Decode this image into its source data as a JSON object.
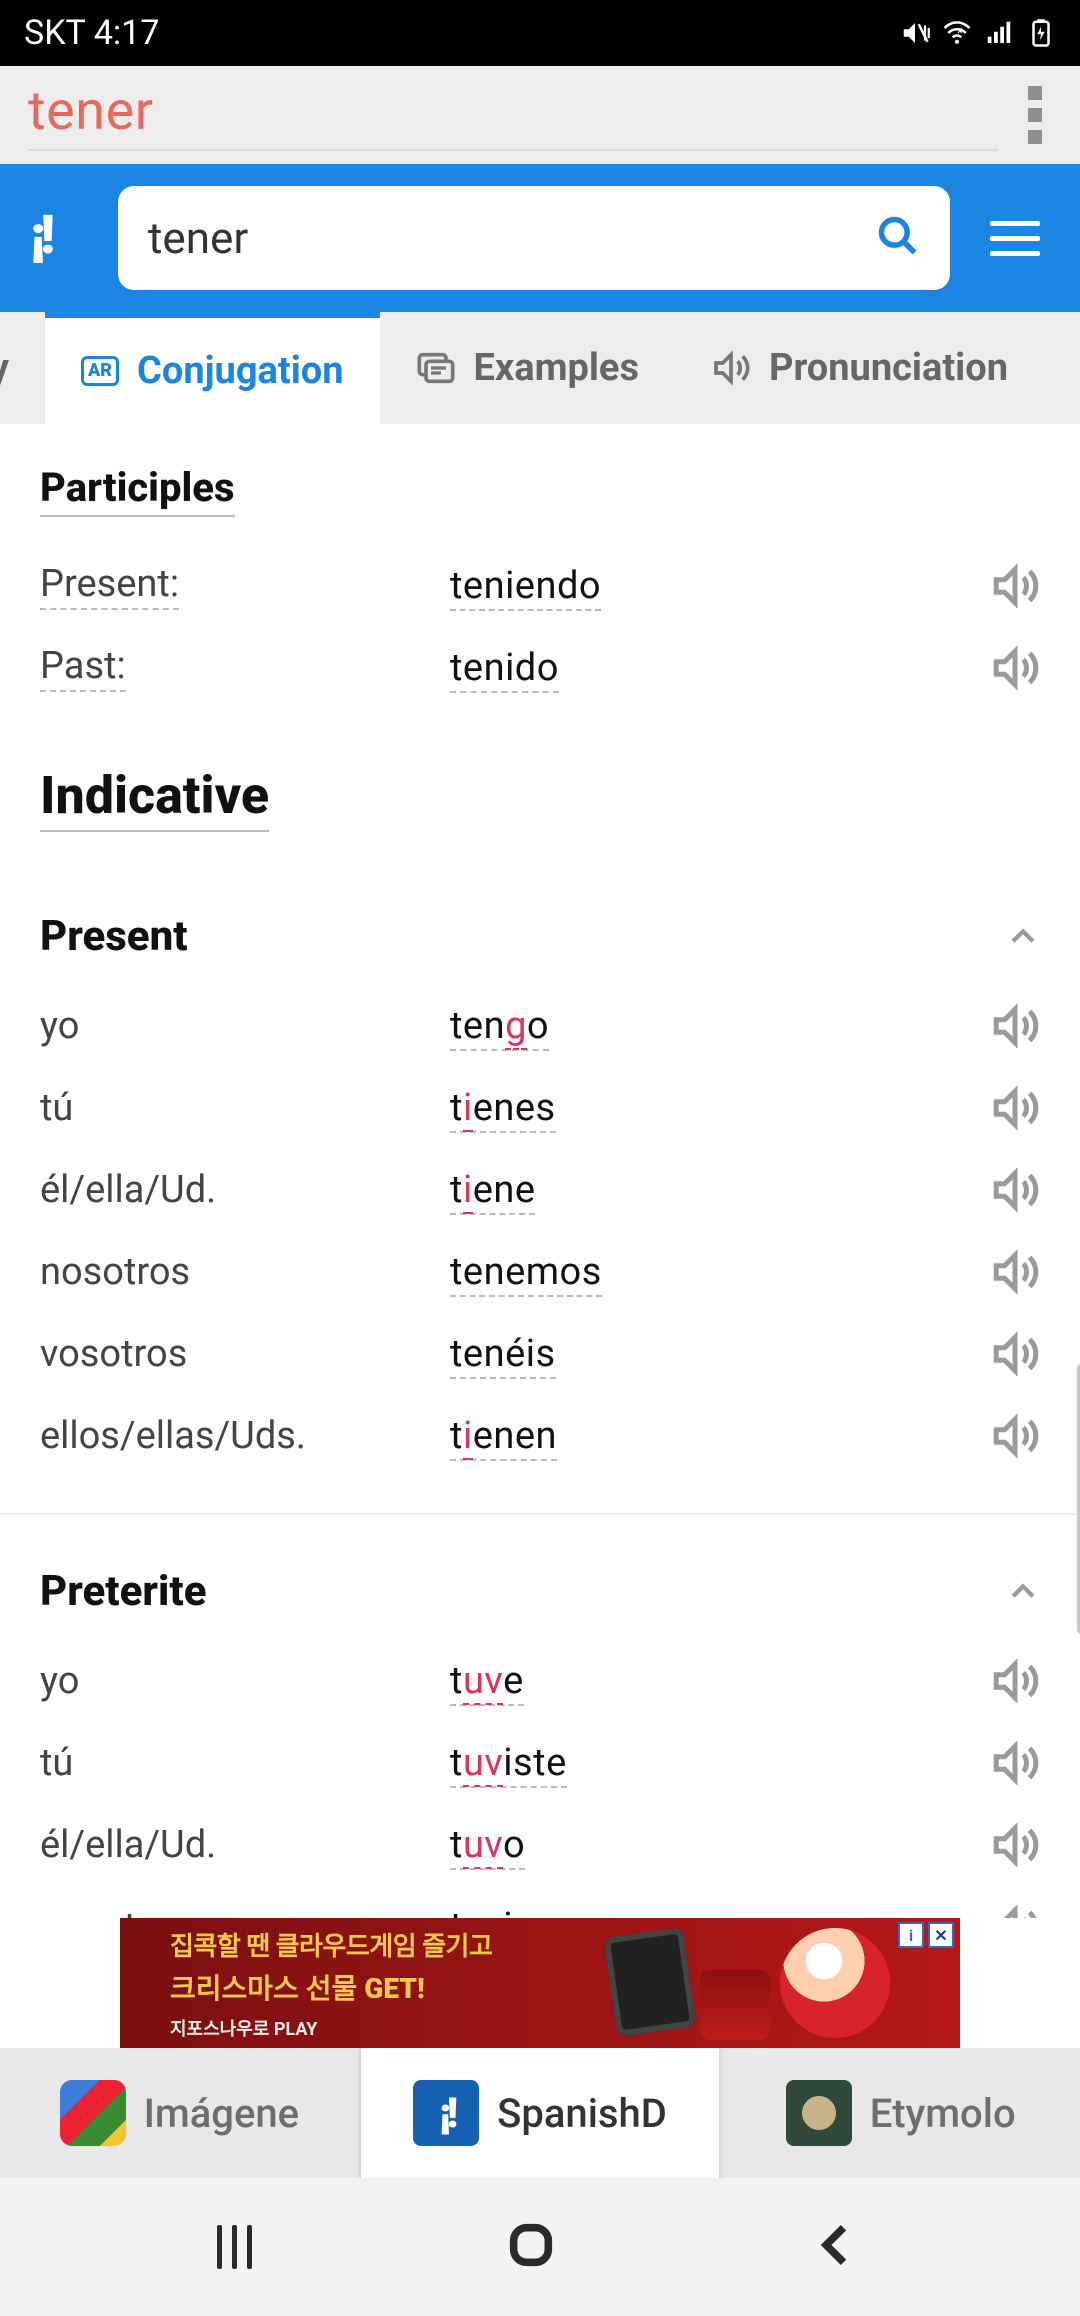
{
  "status": {
    "carrier": "SKT",
    "time": "4:17"
  },
  "urlbar": {
    "title": "tener"
  },
  "search": {
    "value": "tener"
  },
  "tabs": {
    "left_partial": "ry",
    "conjugation": "Conjugation",
    "examples": "Examples",
    "pronunciation": "Pronunciation"
  },
  "sections": {
    "participles": {
      "title": "Participles",
      "present_label": "Present:",
      "present_form": "teniendo",
      "past_label": "Past:",
      "past_form": "tenido"
    },
    "indicative": {
      "title": "Indicative"
    },
    "present": {
      "title": "Present",
      "rows": [
        {
          "pron": "yo",
          "pre": "ten",
          "hl": "g",
          "post": "o"
        },
        {
          "pron": "tú",
          "pre": "t",
          "hl": "i",
          "post": "enes"
        },
        {
          "pron": "él/ella/Ud.",
          "pre": "t",
          "hl": "i",
          "post": "ene"
        },
        {
          "pron": "nosotros",
          "pre": "tenemos",
          "hl": "",
          "post": ""
        },
        {
          "pron": "vosotros",
          "pre": "tenéis",
          "hl": "",
          "post": ""
        },
        {
          "pron": "ellos/ellas/Uds.",
          "pre": "t",
          "hl": "i",
          "post": "enen"
        }
      ]
    },
    "preterite": {
      "title": "Preterite",
      "rows": [
        {
          "pron": "yo",
          "pre": "t",
          "hl": "uv",
          "post": "e"
        },
        {
          "pron": "tú",
          "pre": "t",
          "hl": "uv",
          "post": "iste"
        },
        {
          "pron": "él/ella/Ud.",
          "pre": "t",
          "hl": "uv",
          "post": "o"
        },
        {
          "pron": "nosotros",
          "pre": "t",
          "hl": "uv",
          "post": "imos"
        }
      ]
    }
  },
  "ad": {
    "line1": "집콕할 땐 클라우드게임 즐기고",
    "line2": "크리스마스 선물 GET!",
    "line3": "지포스나우로 PLAY"
  },
  "bottomTabs": {
    "imagenes": "Imágene",
    "spanishd": "SpanishD",
    "etymolo": "Etymolo"
  }
}
